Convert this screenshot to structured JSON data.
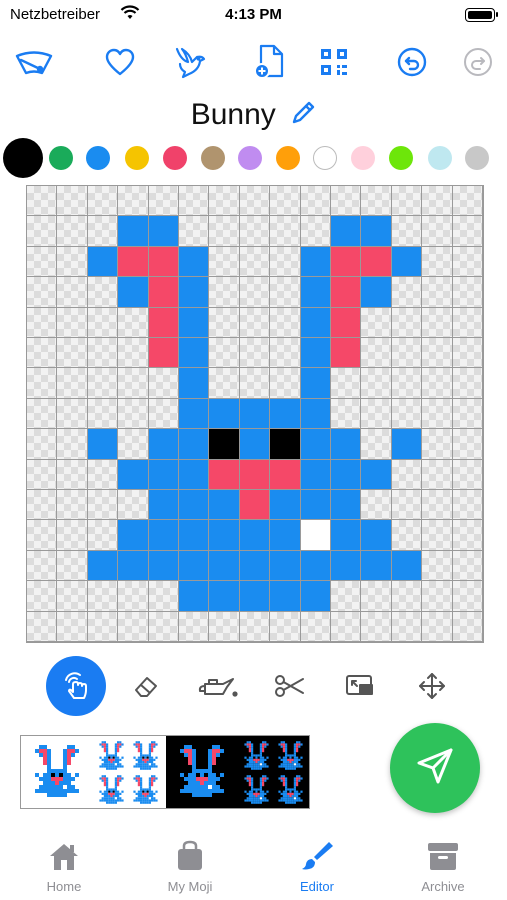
{
  "status_bar": {
    "carrier": "Netzbetreiber",
    "time": "4:13 PM"
  },
  "toolbar": {
    "items": [
      {
        "name": "wiper-tool",
        "icon": "wiper-icon"
      },
      {
        "name": "favorite",
        "icon": "heart-icon"
      },
      {
        "name": "bird",
        "icon": "bird-icon"
      },
      {
        "name": "new-document",
        "icon": "new-document-icon"
      },
      {
        "name": "qr-code",
        "icon": "qr-code-icon"
      },
      {
        "name": "undo",
        "icon": "undo-icon"
      },
      {
        "name": "redo",
        "icon": "redo-icon"
      }
    ]
  },
  "title": "Bunny",
  "palette": {
    "selected": "#000000",
    "colors": [
      "#000000",
      "#1aab5a",
      "#1a8cf0",
      "#f5c400",
      "#f0426a",
      "#b0946e",
      "#c08cf0",
      "#ff9f0a",
      "#ffffff",
      "#ffd0dc",
      "#6de60a",
      "#bfe8f0",
      "#c8c8c8"
    ]
  },
  "grid": {
    "size": 15,
    "legend": {
      "B": "#1a8cf0",
      "R": "#f54868",
      "K": "#000000",
      "W": "#ffffff"
    },
    "rows": [
      "...............",
      "...BB.....BB...",
      "..BRRB...BRRB..",
      "...BRB...BRB...",
      "....RB...BR....",
      "....RB...BR....",
      ".....B...B.....",
      ".....BBBBB.....",
      "..B.BBKBKBB.B..",
      "...BBBRRRBBB...",
      "....BBBRBBB....",
      "...BBBBBBWBB...",
      "..BBBBBBBBBBB..",
      ".....BBBBB.....",
      "..............."
    ]
  },
  "draw_tools": {
    "active": "finger",
    "items": [
      {
        "name": "finger",
        "icon": "finger-draw-icon"
      },
      {
        "name": "eraser",
        "icon": "eraser-icon"
      },
      {
        "name": "fill",
        "icon": "oil-can-icon"
      },
      {
        "name": "cut",
        "icon": "scissors-icon"
      },
      {
        "name": "resize",
        "icon": "resize-icon"
      },
      {
        "name": "move",
        "icon": "move-arrows-icon"
      }
    ]
  },
  "tabs": [
    {
      "label": "Home",
      "icon": "house-icon"
    },
    {
      "label": "My Moji",
      "icon": "bag-icon"
    },
    {
      "label": "Editor",
      "icon": "brush-icon",
      "active": true
    },
    {
      "label": "Archive",
      "icon": "archive-box-icon"
    }
  ]
}
